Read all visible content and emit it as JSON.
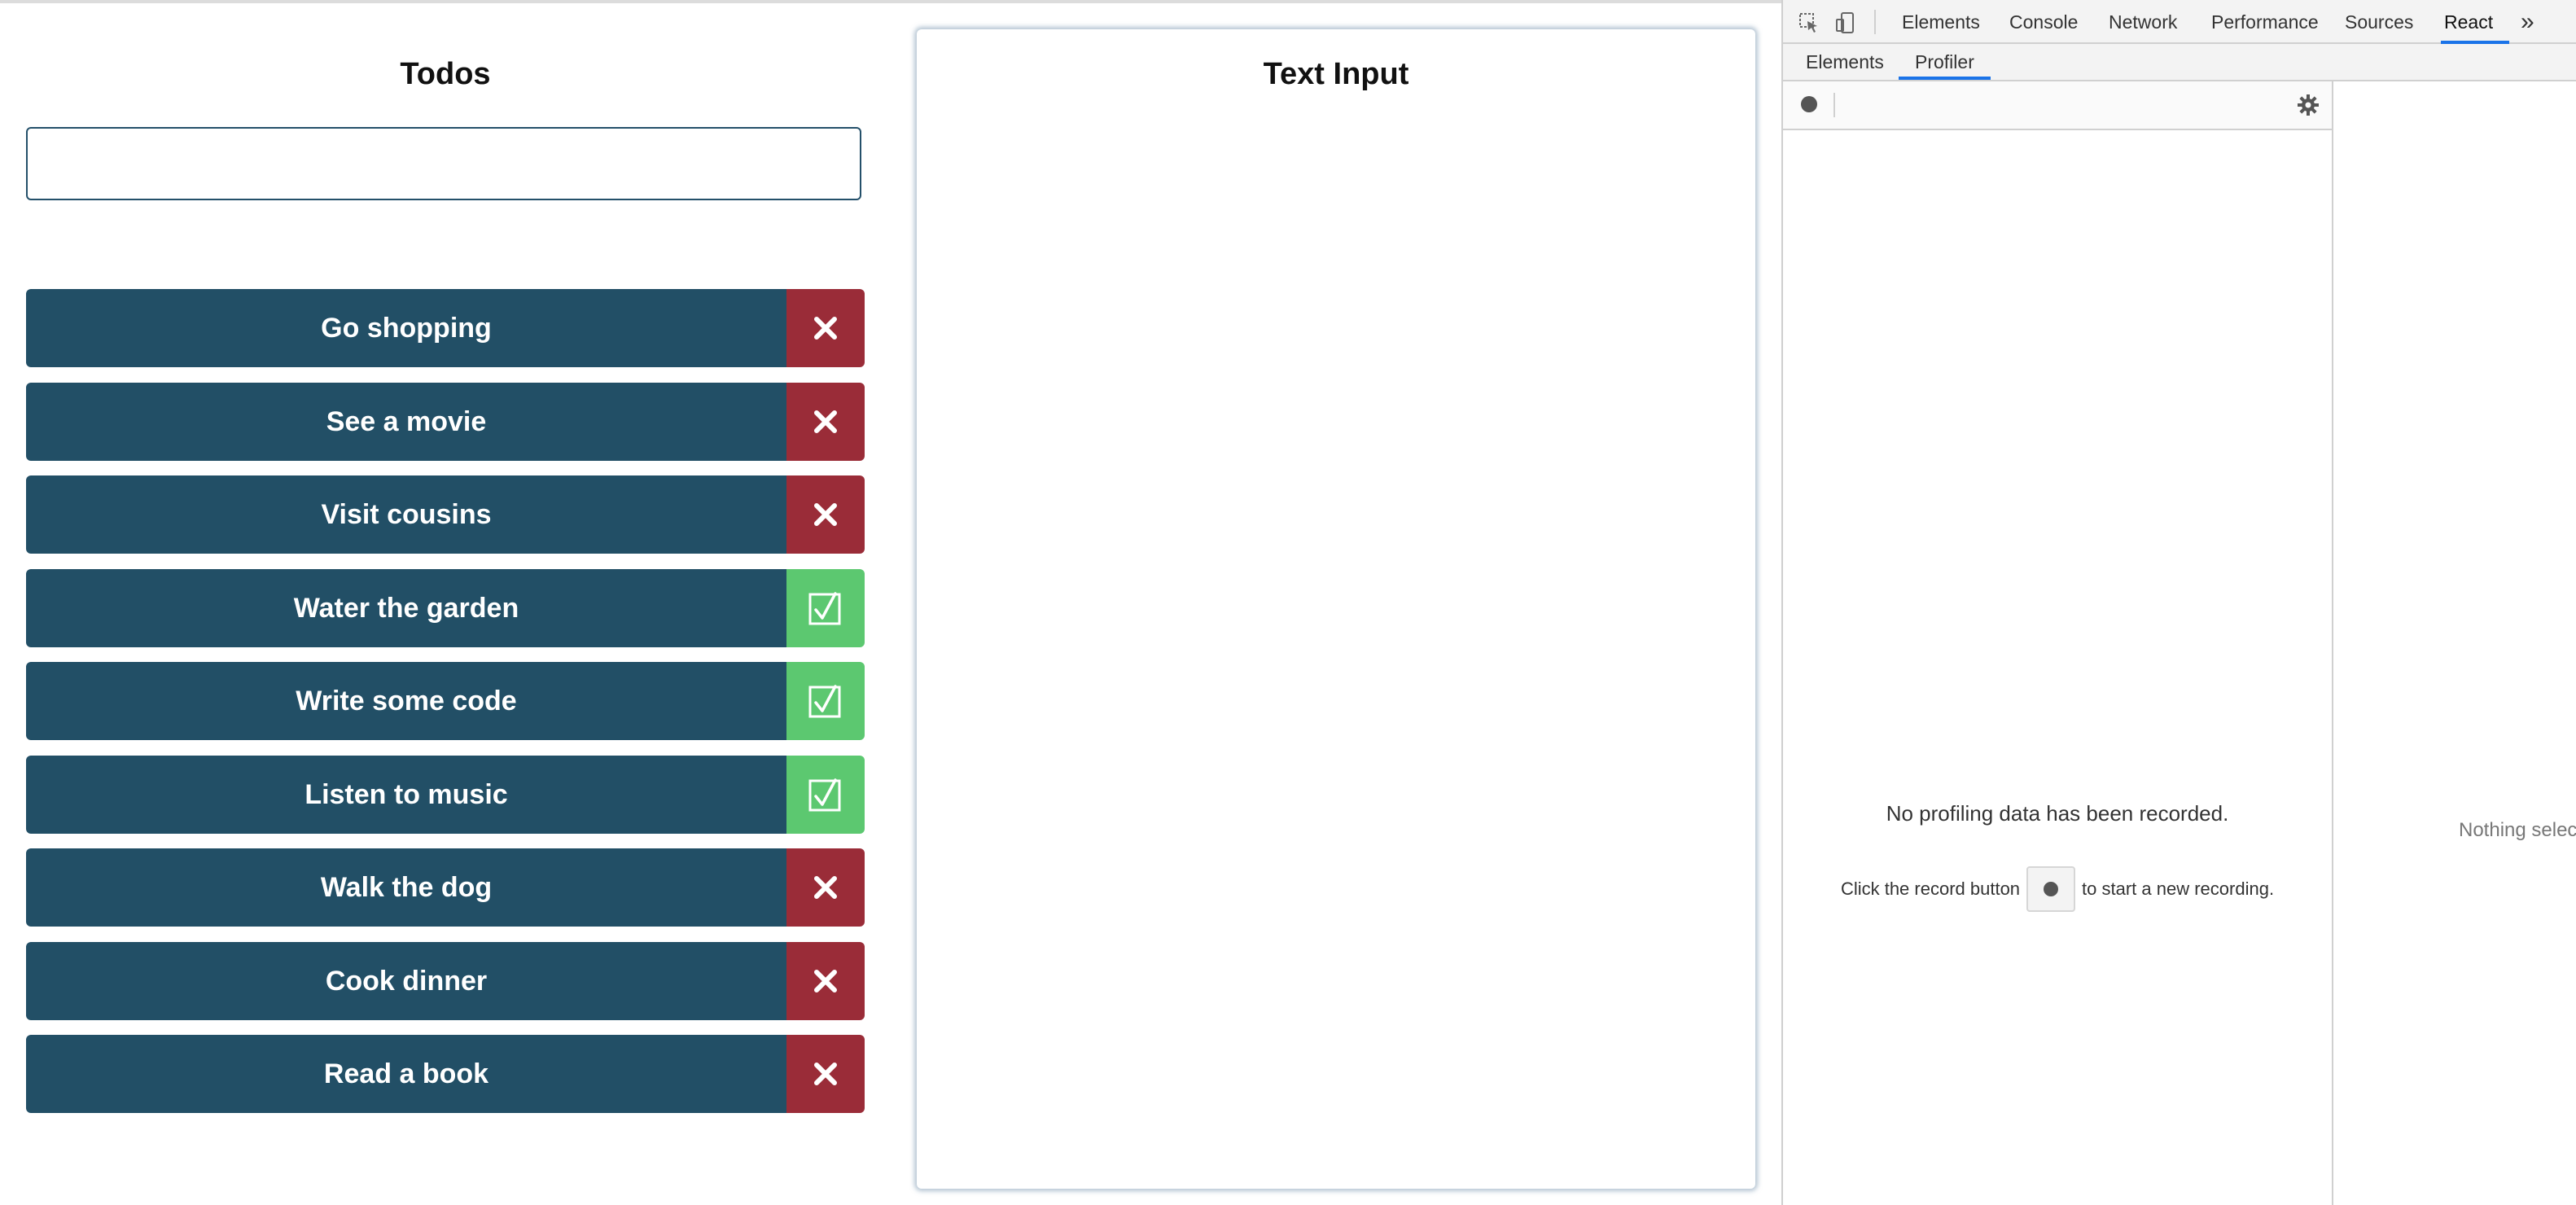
{
  "todos": {
    "title": "Todos",
    "input_value": "",
    "items": [
      {
        "label": "Go shopping",
        "status": "delete"
      },
      {
        "label": "See a movie",
        "status": "delete"
      },
      {
        "label": "Visit cousins",
        "status": "delete"
      },
      {
        "label": "Water the garden",
        "status": "done"
      },
      {
        "label": "Write some code",
        "status": "done"
      },
      {
        "label": "Listen to music",
        "status": "done"
      },
      {
        "label": "Walk the dog",
        "status": "delete"
      },
      {
        "label": "Cook dinner",
        "status": "delete"
      },
      {
        "label": "Read a book",
        "status": "delete"
      }
    ]
  },
  "text_input": {
    "title": "Text Input"
  },
  "devtools": {
    "tabs": [
      "Elements",
      "Console",
      "Network",
      "Performance",
      "Sources",
      "React"
    ],
    "active_tab": "React",
    "more_label": "»",
    "subtabs": [
      "Elements",
      "Profiler"
    ],
    "active_subtab": "Profiler",
    "profiler": {
      "empty_title": "No profiling data has been recorded.",
      "hint_before": "Click the record button",
      "hint_after": "to start a new recording.",
      "nothing_selected": "Nothing selec"
    }
  },
  "colors": {
    "todo_bg": "#224f66",
    "delete_bg": "#9a2c38",
    "done_bg": "#5cc870",
    "devtools_accent": "#1a73e8"
  }
}
